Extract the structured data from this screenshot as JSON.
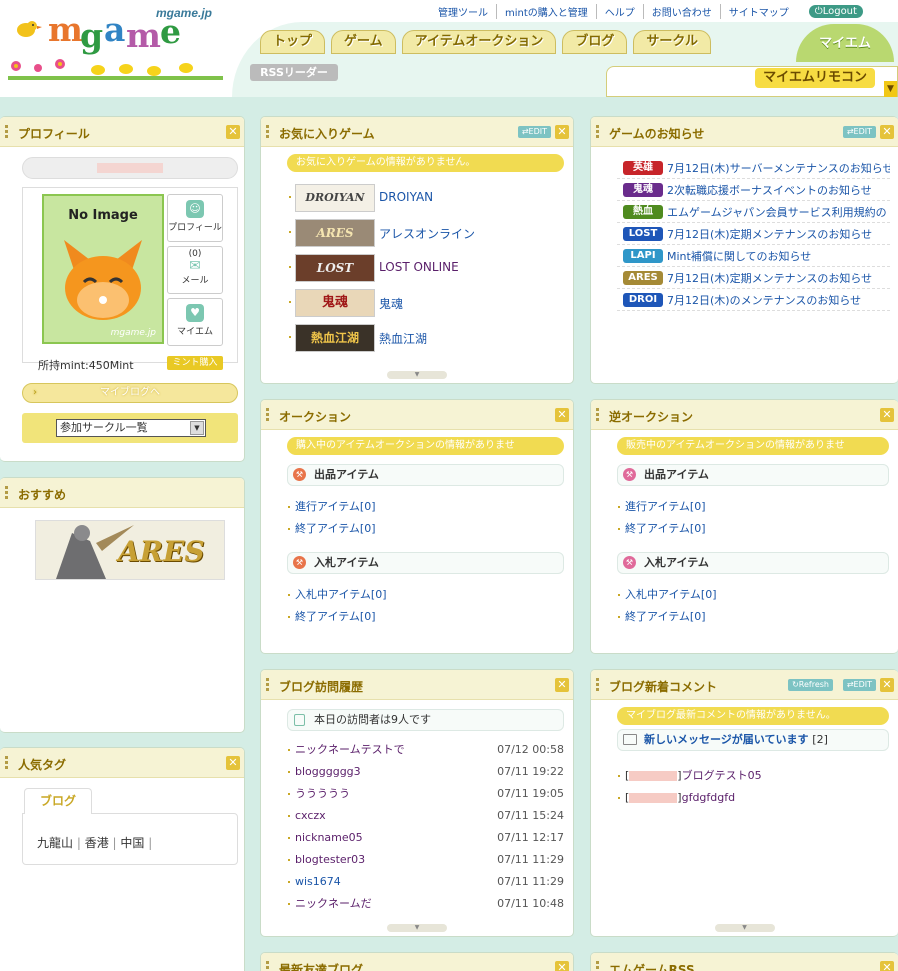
{
  "header": {
    "brand": "mgame.jp",
    "util_links": [
      "管理ツール",
      "mintの購入と管理",
      "ヘルプ",
      "お問い合わせ",
      "サイトマップ"
    ],
    "logout": "Logout",
    "nav": [
      "トップ",
      "ゲーム",
      "アイテムオークション",
      "ブログ",
      "サークル"
    ],
    "nav_active": "マイエム",
    "rss_reader": "RSSリーダー",
    "remocon": "マイエムリモコン"
  },
  "profile": {
    "title": "プロフィール",
    "no_image": "No Image",
    "image_caption": "mgame.jp",
    "btn_profile": "プロフィール",
    "mail_count": "(0)",
    "btn_mail": "メール",
    "btn_myem": "マイエム",
    "mint": "所持mint:450Mint",
    "mint_buy": "ミント購入",
    "myblog": "マイブログへ",
    "circle_select": "参加サークル一覧"
  },
  "recommend": {
    "title": "おすすめ",
    "banner": "ARES"
  },
  "tags": {
    "title": "人気タグ",
    "tab": "ブログ",
    "items": [
      "九龍山",
      "香港",
      "中国"
    ]
  },
  "fav_games": {
    "title": "お気に入りゲーム",
    "edit": "EDIT",
    "notice": "お気に入りゲームの情報がありません。",
    "games": [
      {
        "thumb": "DROIYAN",
        "name": "DROIYAN"
      },
      {
        "thumb": "ARES",
        "name": "アレスオンライン"
      },
      {
        "thumb": "LOST",
        "name": "LOST ONLINE"
      },
      {
        "thumb": "鬼魂",
        "name": "鬼魂"
      },
      {
        "thumb": "熱血江湖",
        "name": "熱血江湖"
      }
    ]
  },
  "game_news": {
    "title": "ゲームのお知らせ",
    "edit": "EDIT",
    "items": [
      {
        "badge": "英雄",
        "color": "#c7252a",
        "text": "7月12日(木)サーバーメンテナンスのお知らせ"
      },
      {
        "badge": "鬼魂",
        "color": "#6a2c8c",
        "text": "2次転職応援ボーナスイベントのお知らせ"
      },
      {
        "badge": "熱血",
        "color": "#4f8b1f",
        "text": "エムゲームジャパン会員サービス利用規約の"
      },
      {
        "badge": "LOST",
        "color": "#1e56b8",
        "text": "7月12日(木)定期メンテナンスのお知らせ"
      },
      {
        "badge": "LAPI",
        "color": "#2f97c9",
        "text": "Mint補償に関してのお知らせ"
      },
      {
        "badge": "ARES",
        "color": "#a58a36",
        "text": "7月12日(木)定期メンテナンスのお知らせ"
      },
      {
        "badge": "DROI",
        "color": "#1e56b8",
        "text": "7月12日(木)のメンテナンスのお知らせ"
      }
    ]
  },
  "auction": {
    "title": "オークション",
    "notice": "購入中のアイテムオークションの情報がありませ",
    "sec1": "出品アイテム",
    "sec1_links": [
      "進行アイテム[0]",
      "終了アイテム[0]"
    ],
    "sec2": "入札アイテム",
    "sec2_links": [
      "入札中アイテム[0]",
      "終了アイテム[0]"
    ]
  },
  "rev_auction": {
    "title": "逆オークション",
    "notice": "販売中のアイテムオークションの情報がありませ",
    "sec1": "出品アイテム",
    "sec1_links": [
      "進行アイテム[0]",
      "終了アイテム[0]"
    ],
    "sec2": "入札アイテム",
    "sec2_links": [
      "入札中アイテム[0]",
      "終了アイテム[0]"
    ]
  },
  "visits": {
    "title": "ブログ訪問履歴",
    "today": "本日の訪問者は9人です",
    "rows": [
      {
        "name": "ニックネームテストで",
        "time": "07/12 00:58"
      },
      {
        "name": "blogggggg3",
        "time": "07/11 19:22"
      },
      {
        "name": "ううううう",
        "time": "07/11 19:05"
      },
      {
        "name": "cxczx",
        "time": "07/11 15:24"
      },
      {
        "name": "nickname05",
        "time": "07/11 12:17"
      },
      {
        "name": "blogtester03",
        "time": "07/11 11:29"
      },
      {
        "name": "wis1674",
        "time": "07/11 11:29"
      },
      {
        "name": "ニックネームだ",
        "time": "07/11 10:48"
      }
    ]
  },
  "comments": {
    "title": "ブログ新着コメント",
    "refresh": "Refresh",
    "edit": "EDIT",
    "notice": "マイブログ最新コメントの情報がありません。",
    "msg_label": "新しいメッセージが届いています",
    "msg_count": "[2]",
    "items": [
      "ブログテスト05",
      "gfdgfdgfd"
    ]
  },
  "bottom": {
    "friends": "最新友達ブログ",
    "rss": "エムゲームRSS"
  }
}
